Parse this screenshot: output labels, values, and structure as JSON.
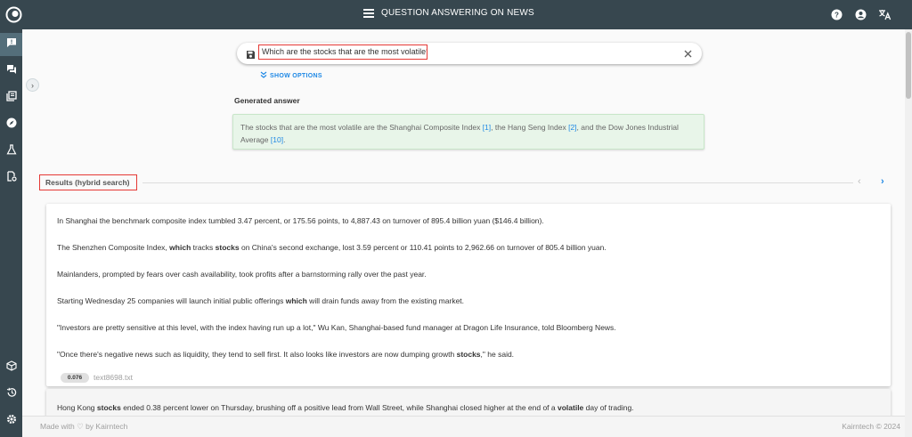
{
  "header": {
    "title": "QUESTION ANSWERING ON NEWS",
    "icons": [
      "help-icon",
      "account-icon",
      "translate-icon"
    ]
  },
  "sidebar": {
    "items": [
      {
        "icon": "qa-chat-icon",
        "active": true
      },
      {
        "icon": "conversation-icon",
        "active": false
      },
      {
        "icon": "library-icon",
        "active": false
      },
      {
        "icon": "explore-icon",
        "active": false
      },
      {
        "icon": "lab-flask-icon",
        "active": false
      },
      {
        "icon": "document-settings-icon",
        "active": false
      },
      {
        "icon": "cube-icon",
        "active": false
      },
      {
        "icon": "history-icon",
        "active": false
      },
      {
        "icon": "gear-icon",
        "active": false
      }
    ]
  },
  "search": {
    "query": "Which are the stocks that are the most volatile?",
    "show_options": "SHOW OPTIONS"
  },
  "answer": {
    "label": "Generated answer",
    "t1": "The stocks that are the most volatile are the Shanghai Composite Index ",
    "r1": "[1]",
    "t2": ", the Hang Seng Index ",
    "r2": "[2]",
    "t3": ", and the Dow Jones Industrial Average ",
    "r3": "[10]",
    "t4": "."
  },
  "results": {
    "title": "Results (hybrid search)",
    "card1": {
      "p1": "In Shanghai the benchmark composite index tumbled 3.47 percent, or 175.56 points, to 4,887.43 on turnover of 895.4 billion yuan ($146.4 billion).",
      "p2a": "The Shenzhen Composite Index, ",
      "p2b": "which",
      "p2c": " tracks ",
      "p2d": "stocks",
      "p2e": " on China's second exchange, lost 3.59 percent or 110.41 points to 2,962.66 on turnover of 805.4 billion yuan.",
      "p3": "Mainlanders, prompted by fears over cash availability, took profits after a barnstorming rally over the past year.",
      "p4a": "Starting Wednesday 25 companies will launch initial public offerings  ",
      "p4b": "which",
      "p4c": " will drain funds away from the existing market.",
      "p5": "\"Investors are pretty sensitive at this level, with the index having run up a lot,\" Wu Kan, Shanghai-based fund manager at Dragon Life Insurance, told Bloomberg News.",
      "p6a": "\"Once there's negative news such as liquidity, they tend to sell first. It also looks like investors are now dumping growth ",
      "p6b": "stocks",
      "p6c": ",\" he said.",
      "score": "0.076",
      "file": "text8698.txt"
    },
    "card2": {
      "a": "Hong Kong ",
      "b": "stocks",
      "c": " ended 0.38 percent lower on Thursday, brushing off a positive lead from Wall Street, while Shanghai closed higher at the end of a ",
      "d": "volatile",
      "e": " day of trading."
    }
  },
  "footer": {
    "left": "Made with ♡ by Kairntech",
    "right": "Kairntech © 2024"
  },
  "colors": {
    "topbar": "#37474f",
    "accent": "#1e88e5",
    "highlight_border": "#e53935",
    "answer_bg": "#e8f5e9"
  }
}
